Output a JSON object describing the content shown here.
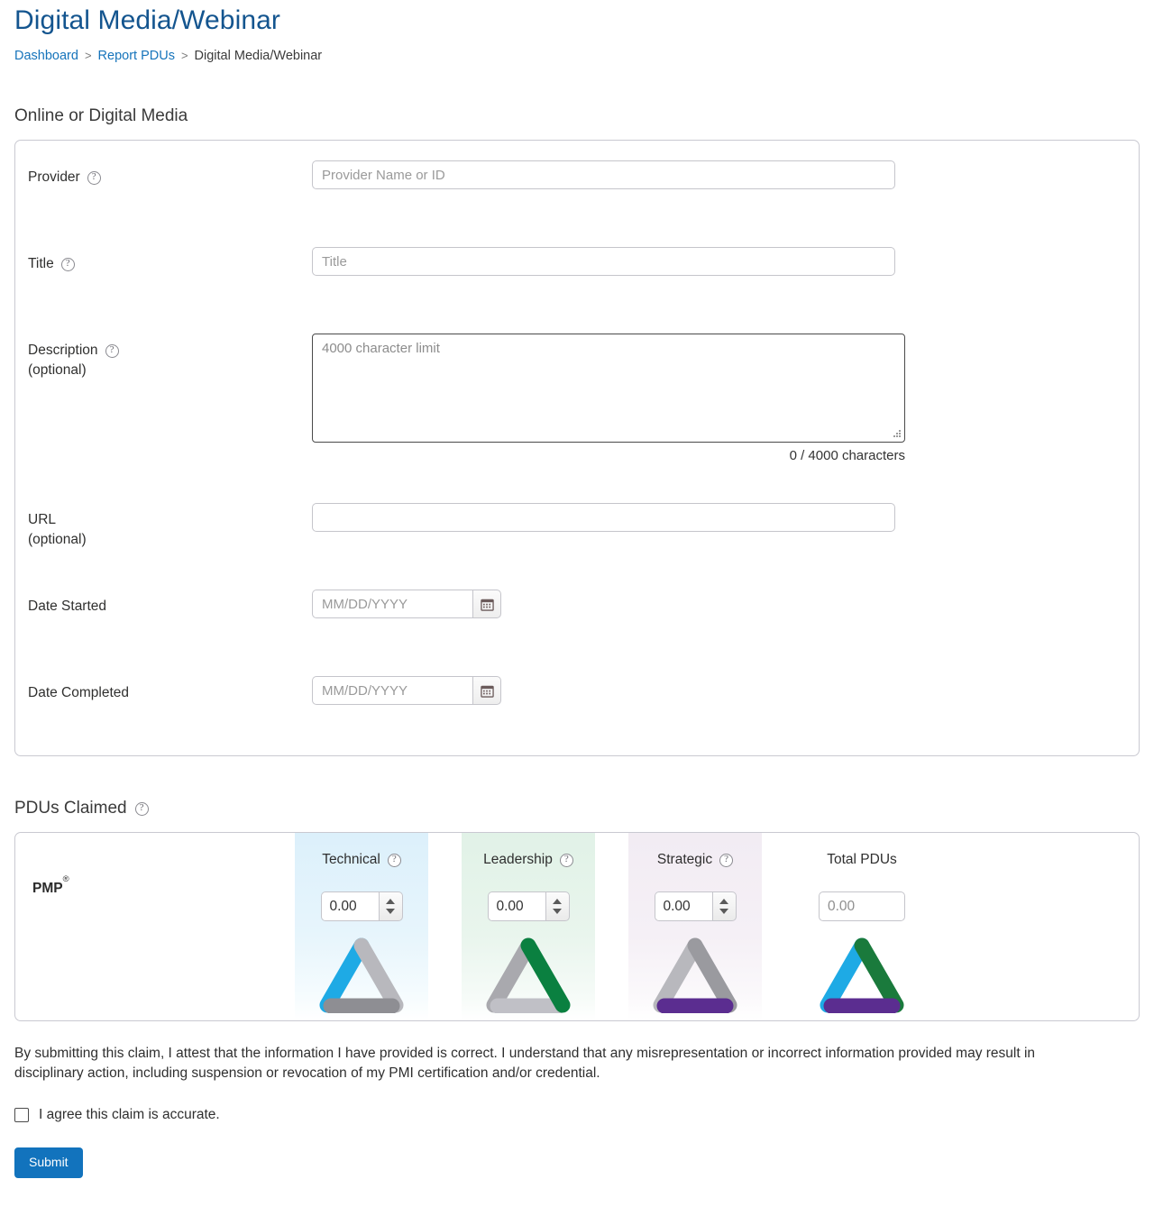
{
  "header": {
    "title": "Digital Media/Webinar",
    "breadcrumb": [
      {
        "label": "Dashboard",
        "link": true
      },
      {
        "label": "Report PDUs",
        "link": true
      },
      {
        "label": "Digital Media/Webinar",
        "link": false
      }
    ],
    "separator": ">"
  },
  "form_section": {
    "heading": "Online or Digital Media",
    "fields": {
      "provider": {
        "label": "Provider",
        "help_icon": "question-mark-circle-icon",
        "placeholder": "Provider Name or ID",
        "value": ""
      },
      "title": {
        "label": "Title",
        "help_icon": "question-mark-circle-icon",
        "placeholder": "Title",
        "value": ""
      },
      "description": {
        "label": "Description",
        "label_sub": "(optional)",
        "help_icon": "question-mark-circle-icon",
        "placeholder": "4000 character limit",
        "value": "",
        "counter": "0 / 4000 characters"
      },
      "url": {
        "label": "URL",
        "label_sub": "(optional)",
        "placeholder": "",
        "value": ""
      },
      "date_started": {
        "label": "Date Started",
        "placeholder": "MM/DD/YYYY",
        "value": "",
        "calendar_icon": "calendar-icon"
      },
      "date_completed": {
        "label": "Date Completed",
        "placeholder": "MM/DD/YYYY",
        "value": "",
        "calendar_icon": "calendar-icon"
      }
    }
  },
  "pdus_claimed": {
    "heading": "PDUs Claimed",
    "help_icon": "question-mark-circle-icon",
    "row_label": "PMP",
    "row_label_sup": "®",
    "columns": [
      {
        "key": "technical",
        "label": "Technical",
        "help_icon": "question-mark-circle-icon",
        "value": "0.00",
        "tint": "#dcf0fb",
        "accent": "#1eaae5",
        "triangle": {
          "left": "#1eaae5",
          "right": "#b8b8bd",
          "bottom": "#8e8e93"
        }
      },
      {
        "key": "leadership",
        "label": "Leadership",
        "help_icon": "question-mark-circle-icon",
        "value": "0.00",
        "tint": "#e1f2e7",
        "accent": "#0a8040",
        "triangle": {
          "left": "#a9a9ae",
          "right": "#0a8040",
          "bottom": "#c0c0c6"
        }
      },
      {
        "key": "strategic",
        "label": "Strategic",
        "help_icon": "question-mark-circle-icon",
        "value": "0.00",
        "tint": "#f2ecf3",
        "accent": "#5b2d90",
        "triangle": {
          "left": "#b8b8bd",
          "right": "#9a9a9f",
          "bottom": "#5b2d90"
        }
      }
    ],
    "total": {
      "key": "total",
      "label": "Total PDUs",
      "value": "",
      "placeholder": "0.00",
      "triangle": {
        "left": "#1eaae5",
        "right": "#1a7a3c",
        "bottom": "#5b2d90"
      }
    }
  },
  "footer": {
    "attestation": "By submitting this claim, I attest that the information I have provided is correct. I understand that any misrepresentation or incorrect information provided may result in disciplinary action, including suspension or revocation of my PMI certification and/or credential.",
    "agree_label": "I agree this claim is accurate.",
    "agree_checked": false,
    "submit_label": "Submit"
  },
  "colors": {
    "title_blue": "#14558f",
    "link_blue": "#1674bb",
    "submit_blue": "#1273bd",
    "border_gray": "#c9c9d1"
  }
}
